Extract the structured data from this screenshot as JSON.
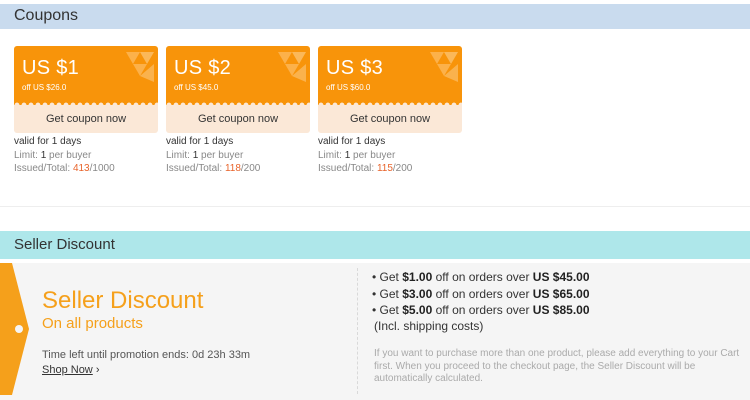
{
  "coupons_section": {
    "title": "Coupons",
    "items": [
      {
        "amount": "US $1",
        "off": "off US $26.0",
        "button": "Get coupon now",
        "valid_prefix": "valid for",
        "valid_days": "1",
        "valid_suffix": "days",
        "limit_prefix": "Limit:",
        "limit_count": "1",
        "limit_suffix": "per buyer",
        "issued_label": "Issued/Total:",
        "issued": "413",
        "total": "/1000"
      },
      {
        "amount": "US $2",
        "off": "off US $45.0",
        "button": "Get coupon now",
        "valid_prefix": "valid for",
        "valid_days": "1",
        "valid_suffix": "days",
        "limit_prefix": "Limit:",
        "limit_count": "1",
        "limit_suffix": "per buyer",
        "issued_label": "Issued/Total:",
        "issued": "118",
        "total": "/200"
      },
      {
        "amount": "US $3",
        "off": "off US $60.0",
        "button": "Get coupon now",
        "valid_prefix": "valid for",
        "valid_days": "1",
        "valid_suffix": "days",
        "limit_prefix": "Limit:",
        "limit_count": "1",
        "limit_suffix": "per buyer",
        "issued_label": "Issued/Total:",
        "issued": "115",
        "total": "/200"
      }
    ]
  },
  "seller_discount": {
    "section_title": "Seller Discount",
    "title": "Seller Discount",
    "subtitle": "On all products",
    "time_label": "Time left until promotion ends:",
    "time_value": "0d 23h 33m",
    "shop_now": "Shop Now",
    "rules": [
      {
        "pre": "Get",
        "amount": "$1.00",
        "mid": "off on orders over",
        "threshold": "US $45.00"
      },
      {
        "pre": "Get",
        "amount": "$3.00",
        "mid": "off on orders over",
        "threshold": "US $65.00"
      },
      {
        "pre": "Get",
        "amount": "$5.00",
        "mid": "off on orders over",
        "threshold": "US $85.00"
      }
    ],
    "shipping_note": "(Incl. shipping costs)",
    "note": "If you want to purchase more than one product, please add everything to your Cart first. When you proceed to the checkout page, the Seller Discount will be automatically calculated."
  },
  "colors": {
    "coupon_orange": "#f8940a",
    "coupon_button_bg": "#fbe8d7",
    "highlight_red": "#e8642b",
    "discount_orange": "#f5a01b",
    "coupons_header_bg": "#c9dbee",
    "seller_header_bg": "#aee7ea"
  },
  "icons": {
    "coupon_decoration": "orange-geometric-pattern",
    "tag": "orange-tag-arrow",
    "shop_now_arrow": "chevron-right"
  }
}
